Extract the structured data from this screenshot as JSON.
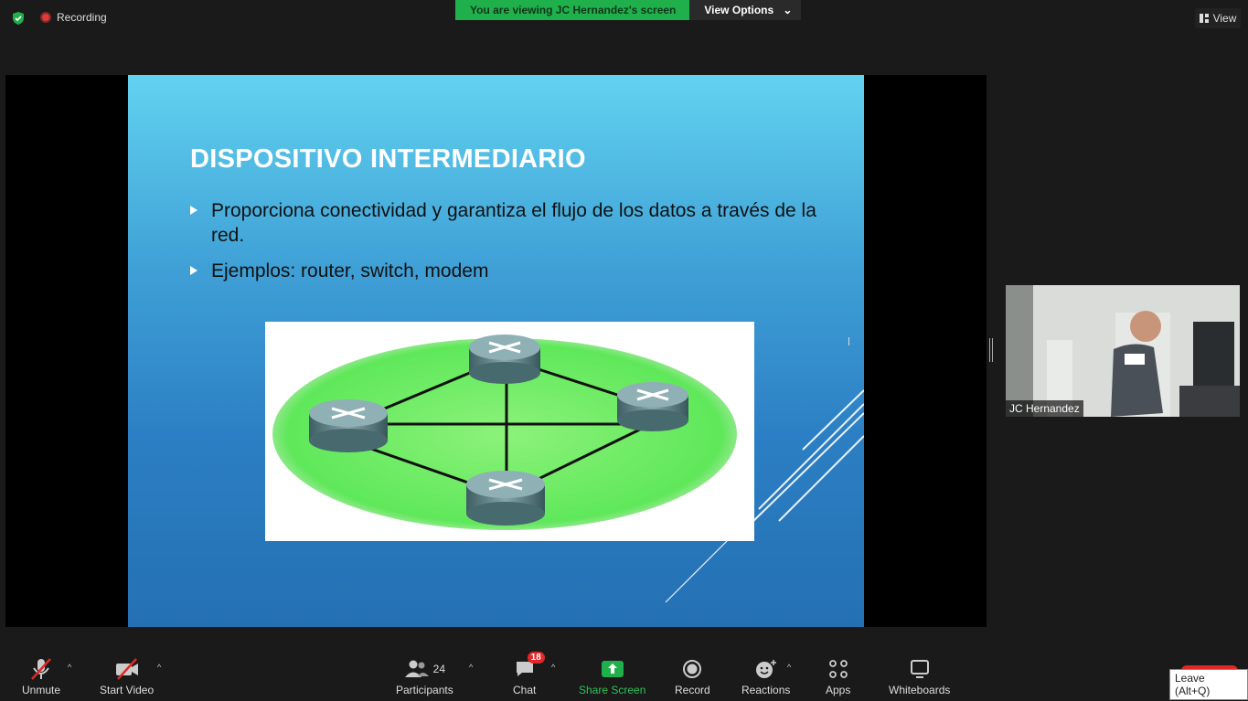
{
  "topbar": {
    "recording_label": "Recording",
    "viewing_text": "You are viewing JC Hernandez's screen",
    "view_options_label": "View Options",
    "view_label": "View"
  },
  "slide": {
    "title": "DISPOSITIVO INTERMEDIARIO",
    "bullets": [
      "Proporciona conectividad y garantiza el flujo de los datos a través de la red.",
      "Ejemplos: router, switch, modem"
    ]
  },
  "participant_video": {
    "name": "JC Hernandez"
  },
  "toolbar": {
    "unmute_label": "Unmute",
    "start_video_label": "Start Video",
    "participants_label": "Participants",
    "participants_count": "24",
    "chat_label": "Chat",
    "chat_badge": "18",
    "share_screen_label": "Share Screen",
    "record_label": "Record",
    "reactions_label": "Reactions",
    "apps_label": "Apps",
    "whiteboards_label": "Whiteboards"
  },
  "leave_tooltip": "Leave (Alt+Q)",
  "colors": {
    "share_green": "#20b04b",
    "leave_red": "#e02828",
    "toolbar_bg": "#1a1a1a"
  },
  "icons": [
    "shield-icon",
    "record-dot-icon",
    "chevron-down-icon",
    "view-grid-icon",
    "mic-muted-icon",
    "video-off-icon",
    "participants-icon",
    "chat-icon",
    "share-screen-icon",
    "record-icon",
    "reactions-icon",
    "apps-icon",
    "whiteboard-icon",
    "router-icon"
  ]
}
